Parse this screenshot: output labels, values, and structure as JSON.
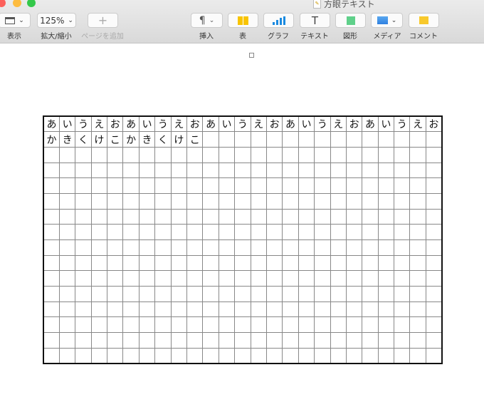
{
  "window": {
    "title": "方眼テキスト"
  },
  "toolbar": {
    "view_label": "表示",
    "zoom_value": "125%",
    "zoom_label": "拡大/縮小",
    "add_page_label": "ページを追加",
    "insert_label": "挿入",
    "table_label": "表",
    "chart_label": "グラフ",
    "text_label": "テキスト",
    "shape_label": "図形",
    "media_label": "メディア",
    "comment_label": "コメント"
  },
  "grid": {
    "columns": 25,
    "rows": 16,
    "content": [
      [
        "あ",
        "い",
        "う",
        "え",
        "お",
        "あ",
        "い",
        "う",
        "え",
        "お",
        "あ",
        "い",
        "う",
        "え",
        "お",
        "あ",
        "い",
        "う",
        "え",
        "お",
        "あ",
        "い",
        "う",
        "え",
        "お"
      ],
      [
        "か",
        "き",
        "く",
        "け",
        "こ",
        "か",
        "き",
        "く",
        "け",
        "こ"
      ]
    ]
  }
}
